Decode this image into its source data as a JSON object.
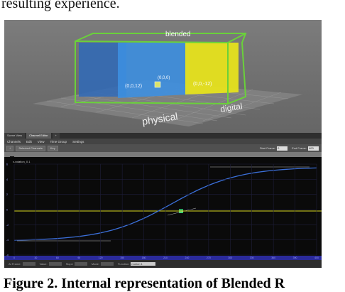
{
  "page": {
    "top_text": "resulting experience.",
    "caption": "Figure 2. Internal representation of Blended R"
  },
  "scene": {
    "label_blended": "blended",
    "label_physical": "physical",
    "label_digital": "digital",
    "coord_left": "(0,0,12)",
    "coord_center": "(0,0,0)",
    "coord_right": "(0,0,-12)",
    "colors": {
      "box_outline": "#6ad13a",
      "physical_volume": "#3d8fe0",
      "digital_volume": "#e6e21c",
      "floor": "#8a8a8a"
    }
  },
  "editor": {
    "tabs": [
      "Scene View",
      "Channel Editor",
      "+"
    ],
    "menu": [
      "Channels",
      "Edit",
      "View",
      "Time Group",
      "Settings"
    ],
    "toolbar": {
      "add_label": "+",
      "channels_dropdown": "Selected Channels",
      "key_button": "Key",
      "start_frame_label": "Start Frame:",
      "start_frame_value": "0",
      "end_frame_label": "End Frame:",
      "end_frame_value": "400"
    },
    "channel_name": "x-rotation_0.1",
    "status": {
      "frame_label": "At Frame:",
      "value_label": "Value:",
      "slope_label": "Slope",
      "mode_label": "Mode:",
      "function_label": "Function:",
      "function_value": "motion 1"
    },
    "x_ticks": [
      "0",
      "30",
      "60",
      "90",
      "120",
      "150",
      "180",
      "210",
      "240",
      "270",
      "300",
      "330",
      "360",
      "390",
      "400"
    ],
    "y_ticks": [
      "6",
      "4",
      "2",
      "0",
      "-2",
      "-4",
      "-6"
    ],
    "curve_color": "#3b6fd9",
    "playhead_color": "#d8d820",
    "key_color": "#2fd26a"
  }
}
